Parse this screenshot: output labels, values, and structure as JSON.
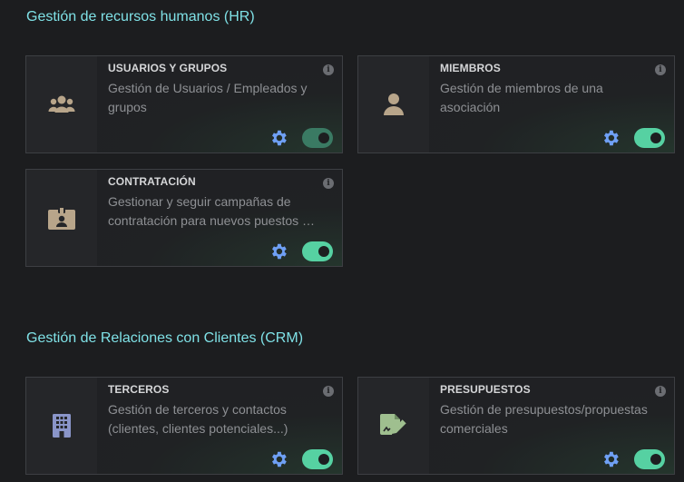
{
  "sections": [
    {
      "title": "Gestión de recursos humanos (HR)",
      "cards": [
        {
          "title": "USUARIOS Y GRUPOS",
          "desc": "Gestión de Usuarios / Empleados y grupos",
          "icon": "users-icon"
        },
        {
          "title": "MIEMBROS",
          "desc": "Gestión de miembros de una asociación",
          "icon": "user-icon"
        },
        {
          "title": "CONTRATACIÓN",
          "desc": "Gestionar y seguir campañas de contratación para nuevos puestos de trabajo",
          "icon": "id-badge-icon"
        }
      ]
    },
    {
      "title": "Gestión de Relaciones con Clientes (CRM)",
      "cards": [
        {
          "title": "TERCEROS",
          "desc": "Gestión de terceros y contactos (clientes, clientes potenciales...)",
          "icon": "building-icon"
        },
        {
          "title": "PRESUPUESTOS",
          "desc": "Gestión de presupuestos/propuestas comerciales",
          "icon": "signed-document-icon"
        }
      ]
    }
  ],
  "colors": {
    "section_title": "#7fe1e6",
    "toggle_on": "#56d1a2",
    "gear": "#6fa0f5",
    "icon_hr": "#b8a58a",
    "icon_crm_building": "#8a95c9",
    "icon_crm_doc": "#9fbf8f"
  }
}
